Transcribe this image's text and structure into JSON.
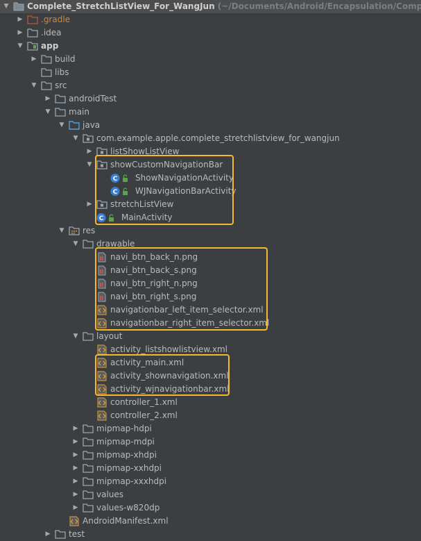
{
  "project": {
    "name": "Complete_StretchListView_For_WangJun",
    "path": "(~/Documents/Android/Encapsulation/Complete_Stretc"
  },
  "tree": [
    {
      "label": "Complete_StretchListView_For_WangJun",
      "path": "(~/Documents/Android/Encapsulation/Complete_Stretc",
      "icon": "project-folder-icon",
      "depth": 0,
      "expanded": true,
      "selected": true,
      "bold": true
    },
    {
      "label": ".gradle",
      "icon": "folder-icon",
      "iconColor": "#c0543e",
      "depth": 1,
      "expanded": false,
      "orange": true
    },
    {
      "label": ".idea",
      "icon": "folder-icon",
      "depth": 1,
      "expanded": false
    },
    {
      "label": "app",
      "icon": "module-folder-icon",
      "depth": 1,
      "expanded": true,
      "bold": true
    },
    {
      "label": "build",
      "icon": "folder-icon",
      "depth": 2,
      "expanded": false
    },
    {
      "label": "libs",
      "icon": "folder-icon",
      "depth": 2
    },
    {
      "label": "src",
      "icon": "folder-icon",
      "depth": 2,
      "expanded": true
    },
    {
      "label": "androidTest",
      "icon": "folder-icon",
      "depth": 3,
      "expanded": false
    },
    {
      "label": "main",
      "icon": "folder-icon",
      "depth": 3,
      "expanded": true
    },
    {
      "label": "java",
      "icon": "source-folder-icon",
      "depth": 4,
      "expanded": true
    },
    {
      "label": "com.example.apple.complete_stretchlistview_for_wangjun",
      "icon": "package-icon",
      "depth": 5,
      "expanded": true
    },
    {
      "label": "listShowListView",
      "icon": "package-icon",
      "depth": 6,
      "expanded": false
    },
    {
      "label": "showCustomNavigationBar",
      "icon": "package-icon",
      "depth": 6,
      "expanded": true
    },
    {
      "label": "ShowNavigationActivity",
      "icon": "class-icon",
      "depth": 7
    },
    {
      "label": "WJNavigationBarActivity",
      "icon": "class-icon",
      "depth": 7
    },
    {
      "label": "stretchListView",
      "icon": "package-icon",
      "depth": 6,
      "expanded": false
    },
    {
      "label": "MainActivity",
      "icon": "class-icon",
      "depth": 6
    },
    {
      "label": "res",
      "icon": "resource-folder-icon",
      "depth": 4,
      "expanded": true
    },
    {
      "label": "drawable",
      "icon": "folder-icon",
      "depth": 5,
      "expanded": true
    },
    {
      "label": "navi_btn_back_n.png",
      "icon": "image-file-icon",
      "depth": 6
    },
    {
      "label": "navi_btn_back_s.png",
      "icon": "image-file-icon",
      "depth": 6
    },
    {
      "label": "navi_btn_right_n.png",
      "icon": "image-file-icon",
      "depth": 6
    },
    {
      "label": "navi_btn_right_s.png",
      "icon": "image-file-icon",
      "depth": 6
    },
    {
      "label": "navigationbar_left_item_selector.xml",
      "icon": "xml-file-icon",
      "depth": 6
    },
    {
      "label": "navigationbar_right_item_selector.xml",
      "icon": "xml-file-icon",
      "depth": 6
    },
    {
      "label": "layout",
      "icon": "folder-icon",
      "depth": 5,
      "expanded": true
    },
    {
      "label": "activity_listshowlistview.xml",
      "icon": "xml-file-icon",
      "depth": 6
    },
    {
      "label": "activity_main.xml",
      "icon": "xml-file-icon",
      "depth": 6
    },
    {
      "label": "activity_shownavigation.xml",
      "icon": "xml-file-icon",
      "depth": 6
    },
    {
      "label": "activity_wjnavigationbar.xml",
      "icon": "xml-file-icon",
      "depth": 6
    },
    {
      "label": "controller_1.xml",
      "icon": "xml-file-icon",
      "depth": 6
    },
    {
      "label": "controller_2.xml",
      "icon": "xml-file-icon",
      "depth": 6
    },
    {
      "label": "mipmap-hdpi",
      "icon": "folder-icon",
      "depth": 5,
      "expanded": false
    },
    {
      "label": "mipmap-mdpi",
      "icon": "folder-icon",
      "depth": 5,
      "expanded": false
    },
    {
      "label": "mipmap-xhdpi",
      "icon": "folder-icon",
      "depth": 5,
      "expanded": false
    },
    {
      "label": "mipmap-xxhdpi",
      "icon": "folder-icon",
      "depth": 5,
      "expanded": false
    },
    {
      "label": "mipmap-xxxhdpi",
      "icon": "folder-icon",
      "depth": 5,
      "expanded": false
    },
    {
      "label": "values",
      "icon": "folder-icon",
      "depth": 5,
      "expanded": false
    },
    {
      "label": "values-w820dp",
      "icon": "folder-icon",
      "depth": 5,
      "expanded": false
    },
    {
      "label": "AndroidManifest.xml",
      "icon": "xml-file-icon",
      "depth": 4
    },
    {
      "label": "test",
      "icon": "folder-icon",
      "depth": 3,
      "expanded": false
    }
  ],
  "colors": {
    "background": "#3c3f41",
    "text": "#bbbbbb",
    "folder": "#9aa7b0",
    "highlight": "#f5b82e",
    "class_badge": "#4d8ed8"
  }
}
